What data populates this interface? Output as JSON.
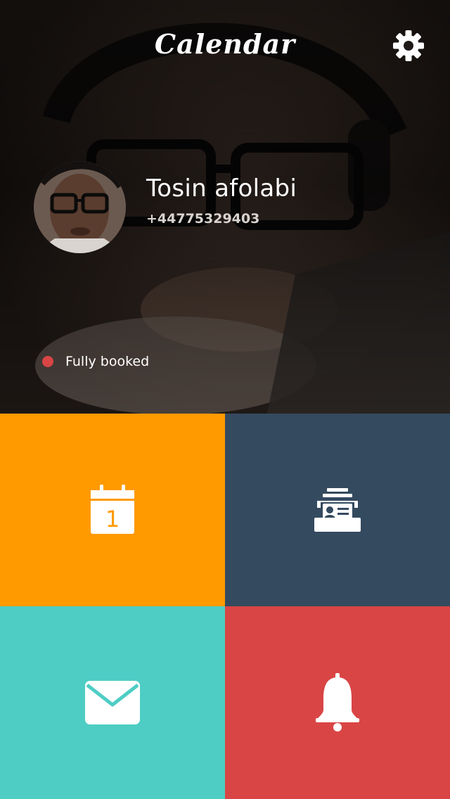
{
  "header": {
    "title": "Calendar",
    "settings_icon": "gear-icon"
  },
  "profile": {
    "name": "Tosin afolabi",
    "phone": "+44775329403",
    "avatar": "profile-photo"
  },
  "status": {
    "label": "Fully booked",
    "color": "#d94545"
  },
  "tiles": [
    {
      "name": "calendar",
      "icon": "calendar-icon",
      "day_number": "1",
      "color": "#ff9a00"
    },
    {
      "name": "contacts",
      "icon": "contact-cards-icon",
      "color": "#344a5f"
    },
    {
      "name": "messages",
      "icon": "envelope-icon",
      "color": "#4ecdc4"
    },
    {
      "name": "notifications",
      "icon": "bell-icon",
      "color": "#d94545"
    }
  ]
}
